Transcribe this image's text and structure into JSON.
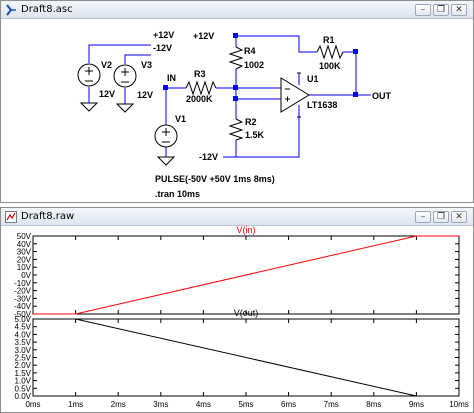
{
  "schematic_window": {
    "title": "Draft8.asc",
    "controls": {
      "minimize": "–",
      "restore": "❐",
      "close": "✕"
    },
    "labels": {
      "v2": "V2",
      "v2_value": "12V",
      "v3": "V3",
      "v3_value": "12V",
      "plus12_v2": "+12V",
      "minus12_v3": "-12V",
      "plus12_r4": "+12V",
      "r4": "R4",
      "r4_value": "1002",
      "r1": "R1",
      "r1_value": "100K",
      "in": "IN",
      "r3": "R3",
      "r3_value": "2000K",
      "u1": "U1",
      "u1_part": "LT1638",
      "out": "OUT",
      "v1": "V1",
      "r2": "R2",
      "r2_value": "1.5K",
      "minus12_u1": "-12V",
      "pulse": "PULSE(-50V +50V 1ms 8ms)",
      "tran": ".tran 10ms"
    }
  },
  "waveform_window": {
    "title": "Draft8.raw",
    "controls": {
      "minimize": "–",
      "restore": "❐",
      "close": "✕"
    }
  },
  "chart_data": [
    {
      "type": "line",
      "title": "V(in)",
      "series": [
        {
          "name": "V(in)",
          "color": "#ff0000",
          "x": [
            0,
            1,
            9,
            10
          ],
          "y": [
            -50,
            -50,
            50,
            50
          ]
        }
      ],
      "xlim": [
        0,
        10
      ],
      "ylim": [
        -50,
        50
      ],
      "yticks": [
        50,
        40,
        30,
        20,
        10,
        0,
        -10,
        -20,
        -30,
        -40,
        -50
      ],
      "yticklabels": [
        "50V",
        "40V",
        "30V",
        "20V",
        "10V",
        "0V",
        "-10V",
        "-20V",
        "-30V",
        "-40V",
        "-50V"
      ],
      "grid": false
    },
    {
      "type": "line",
      "title": "V(out)",
      "series": [
        {
          "name": "V(out)",
          "color": "#000000",
          "x": [
            1,
            9
          ],
          "y": [
            5.0,
            0.0
          ]
        }
      ],
      "xlim": [
        0,
        10
      ],
      "ylim": [
        0,
        5
      ],
      "xticks": [
        0,
        1,
        2,
        3,
        4,
        5,
        6,
        7,
        8,
        9,
        10
      ],
      "xticklabels": [
        "0ms",
        "1ms",
        "2ms",
        "3ms",
        "4ms",
        "5ms",
        "6ms",
        "7ms",
        "8ms",
        "9ms",
        "10ms"
      ],
      "yticks": [
        5.0,
        4.5,
        4.0,
        3.5,
        3.0,
        2.5,
        2.0,
        1.5,
        1.0,
        0.5,
        0.0
      ],
      "yticklabels": [
        "5.0V",
        "4.5V",
        "4.0V",
        "3.5V",
        "3.0V",
        "2.5V",
        "2.0V",
        "1.5V",
        "1.0V",
        "0.5V",
        "0.0V"
      ],
      "grid": false
    }
  ]
}
